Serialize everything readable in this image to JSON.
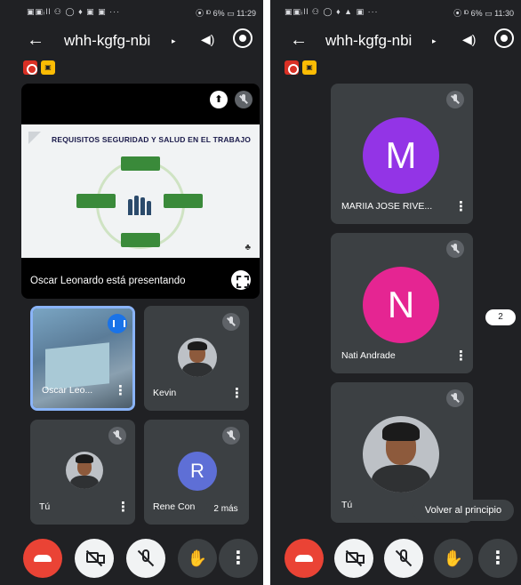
{
  "left_phone": {
    "status": {
      "left_icons": "▣▣ᵢll ⚇ ◯ ♦ ▣ ▣ ···",
      "right": "⦿ ᴵᴰ 6% ▭ 11:29"
    },
    "meeting_code": "whh-kgfg-nbi",
    "presentation": {
      "slide_title": "REQUISITOS SEGURIDAD Y SALUD EN EL TRABAJO",
      "presenting_text": "Oscar Leonardo está presentando"
    },
    "tiles": [
      {
        "name": "Oscar Leo..."
      },
      {
        "name": "Kevin"
      },
      {
        "name": "Tú"
      },
      {
        "name": "Rene Con",
        "initial": "R"
      }
    ],
    "more_chip": "2 más"
  },
  "right_phone": {
    "status": {
      "left_icons": "▣▣ᵢll ⚇ ◯ ♦ ▲ ▣ ···",
      "right": "⦿ ᴵᴰ 6% ▭ 11:30"
    },
    "meeting_code": "whh-kgfg-nbi",
    "tiles": [
      {
        "name": "MARIIA JOSE RIVE...",
        "initial": "M",
        "color": "#9334e6"
      },
      {
        "name": "Nati Andrade",
        "initial": "N",
        "color": "#e52592"
      },
      {
        "name": "Tú"
      }
    ],
    "page_chip": "2",
    "back_to_top": "Volver al principio"
  },
  "colors": {
    "end_call": "#ea4335",
    "speaking": "#8ab4f8",
    "rene_avatar": "#5e6fd6"
  },
  "icons": [
    "back-arrow-icon",
    "speaker-icon",
    "camera-switch-icon",
    "record-icon",
    "captions-icon",
    "pin-icon",
    "mic-off-icon",
    "fullscreen-icon",
    "more-vert-icon",
    "end-call-icon",
    "camera-off-icon",
    "raise-hand-icon"
  ]
}
